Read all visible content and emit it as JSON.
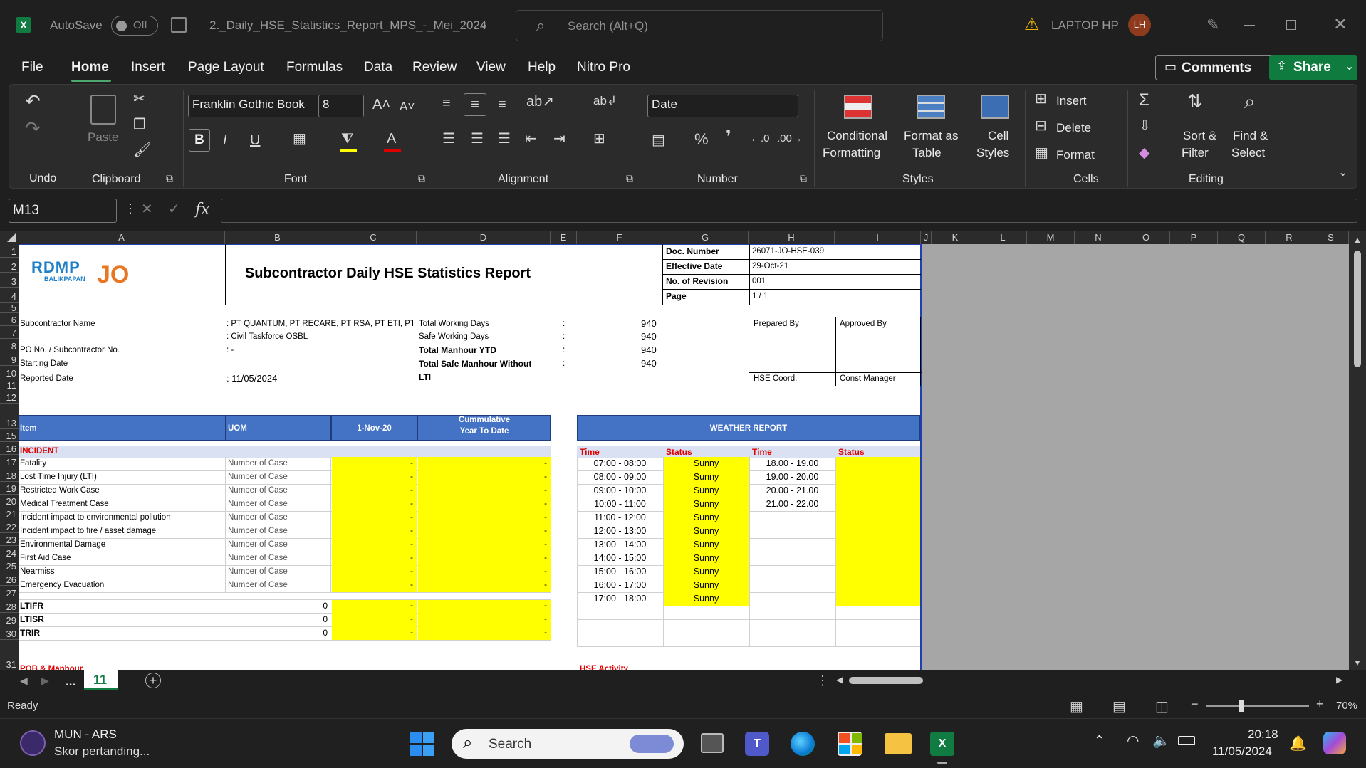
{
  "titlebar": {
    "autosave": "AutoSave",
    "autosave_state": "Off",
    "filename": "2._Daily_HSE_Statistics_Report_MPS_-_Mei_2024",
    "search_placeholder": "Search (Alt+Q)",
    "user": "LAPTOP HP",
    "avatar": "LH"
  },
  "menu": {
    "items": [
      "File",
      "Home",
      "Insert",
      "Page Layout",
      "Formulas",
      "Data",
      "Review",
      "View",
      "Help",
      "Nitro Pro"
    ],
    "comments": "Comments",
    "share": "Share"
  },
  "ribbon": {
    "undo": "Undo",
    "clipboard": "Clipboard",
    "paste": "Paste",
    "font_name": "Franklin Gothic Book",
    "font_size": "8",
    "font": "Font",
    "alignment": "Alignment",
    "number_format": "Date",
    "number": "Number",
    "cond_fmt_1": "Conditional",
    "cond_fmt_2": "Formatting",
    "fmt_table_1": "Format as",
    "fmt_table_2": "Table",
    "cell_styles_1": "Cell",
    "cell_styles_2": "Styles",
    "styles": "Styles",
    "insert": "Insert",
    "delete": "Delete",
    "format": "Format",
    "cells": "Cells",
    "sort_1": "Sort &",
    "sort_2": "Filter",
    "find_1": "Find &",
    "find_2": "Select",
    "editing": "Editing"
  },
  "formula": {
    "name_box": "M13",
    "fx": "fx"
  },
  "columns": [
    "A",
    "B",
    "C",
    "D",
    "E",
    "F",
    "G",
    "H",
    "I",
    "J",
    "K",
    "L",
    "M",
    "N",
    "O",
    "P",
    "Q",
    "R",
    "S"
  ],
  "rows": [
    "1",
    "2",
    "3",
    "4",
    "5",
    "6",
    "7",
    "8",
    "9",
    "10",
    "11",
    "12",
    "13",
    "15",
    "16",
    "17",
    "18",
    "19",
    "20",
    "21",
    "22",
    "23",
    "24",
    "25",
    "26",
    "27",
    "28",
    "29",
    "30",
    "31"
  ],
  "sheet": {
    "logo_top": "RDMP",
    "logo_sub": "BALIKPAPAN",
    "logo_jo": "JO",
    "title": "Subcontractor Daily HSE Statistics Report",
    "doc_labels": [
      "Doc. Number",
      "Effective Date",
      "No. of Revision",
      "Page"
    ],
    "doc_values": [
      "26071-JO-HSE-039",
      "29-Oct-21",
      "001",
      "1 / 1"
    ],
    "info_labels": [
      "Subcontractor Name",
      "",
      "PO No. / Subcontractor No.",
      "Starting Date",
      "Reported Date"
    ],
    "info_values": [
      ": PT QUANTUM, PT RECARE, PT RSA, PT ETI, PT MI",
      ": Civil Taskforce OSBL",
      ": -",
      "",
      ": 11/05/2024"
    ],
    "totals_labels": [
      "Total Working Days",
      "Safe Working Days",
      "Total Manhour YTD",
      "Total Safe Manhour Without"
    ],
    "totals_lti": "LTI",
    "totals_colon": ":",
    "totals_values": [
      "940",
      "940",
      "940",
      "940"
    ],
    "prepared_by": "Prepared By",
    "approved_by": "Approved By",
    "hse_coord": "HSE Coord.",
    "const_manager": "Const Manager",
    "hdr_item": "Item",
    "hdr_uom": "UOM",
    "hdr_date": "1-Nov-20",
    "hdr_cum_1": "Cummulative",
    "hdr_cum_2": "Year To Date",
    "weather_title": "WEATHER REPORT",
    "incident": "INCIDENT",
    "incident_items": [
      "Fatality",
      "Lost Time Injury (LTI)",
      "Restricted Work Case",
      "Medical Treatment Case",
      "Incident impact to environmental pollution",
      "Incident impact to fire / asset damage",
      "Environmental Damage",
      "First Aid Case",
      "Nearmiss",
      "Emergency Evacuation"
    ],
    "uom": "Number of Case",
    "dash": "-",
    "rates": [
      "LTIFR",
      "LTISR",
      "TRIR"
    ],
    "rate_values": [
      "0",
      "0",
      "0"
    ],
    "weather_hdr": [
      "Time",
      "Status",
      "Time",
      "Status"
    ],
    "weather_left_times": [
      "07:00 - 08:00",
      "08:00 - 09:00",
      "09:00 - 10:00",
      "10:00 - 11:00",
      "11:00 - 12:00",
      "12:00 - 13:00",
      "13:00 - 14:00",
      "14:00 - 15:00",
      "15:00 - 16:00",
      "16:00 - 17:00",
      "17:00 - 18:00"
    ],
    "weather_left_status": [
      "Sunny",
      "Sunny",
      "Sunny",
      "Sunny",
      "Sunny",
      "Sunny",
      "Sunny",
      "Sunny",
      "Sunny",
      "Sunny",
      "Sunny"
    ],
    "weather_right_times": [
      "18.00 - 19.00",
      "19.00 - 20.00",
      "20.00 - 21.00",
      "21.00 - 22.00"
    ],
    "row31_left": "POB & Manhour",
    "row31_right": "HSE Activity"
  },
  "tabs": {
    "ellipsis": "...",
    "active": "11"
  },
  "status": {
    "ready": "Ready",
    "zoom": "70%"
  },
  "taskbar": {
    "game_title": "MUN - ARS",
    "game_sub": "Skor pertanding...",
    "search": "Search",
    "time": "20:18",
    "date": "11/05/2024"
  }
}
